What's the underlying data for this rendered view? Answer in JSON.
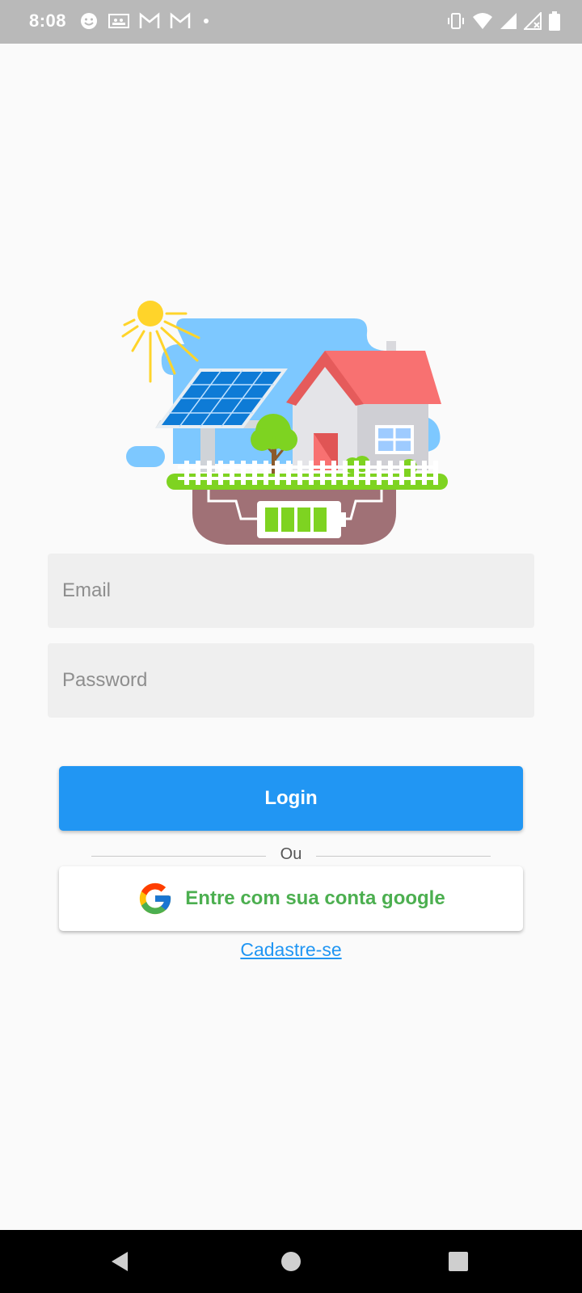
{
  "status_bar": {
    "time": "8:08",
    "left_icons": [
      "smiley-icon",
      "photos-icon",
      "gmail-icon",
      "gmail-icon",
      "dot-icon"
    ],
    "right_icons": [
      "vibrate-icon",
      "wifi-icon",
      "signal-icon",
      "signal-x-icon",
      "battery-icon"
    ]
  },
  "illustration": {
    "icon": "solar-house-illustration"
  },
  "form": {
    "email_placeholder": "Email",
    "password_placeholder": "Password",
    "login_label": "Login",
    "divider_label": "Ou",
    "google_label": "Entre com sua conta google",
    "signup_label": "Cadastre-se"
  },
  "navigation": {
    "buttons": [
      "back-icon",
      "home-icon",
      "recents-icon"
    ]
  },
  "colors": {
    "status_bar": "#b9b9b9",
    "background": "#fafafa",
    "primary": "#2196f3",
    "google_text": "#4caf50",
    "input_background": "#efefef"
  }
}
